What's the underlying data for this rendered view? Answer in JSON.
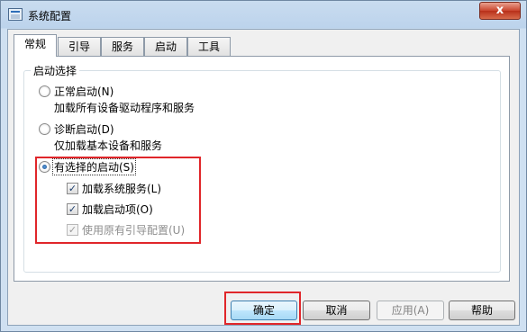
{
  "window": {
    "title": "系统配置",
    "close_glyph": "x"
  },
  "tabs": [
    {
      "label": "常规",
      "active": true
    },
    {
      "label": "引导",
      "active": false
    },
    {
      "label": "服务",
      "active": false
    },
    {
      "label": "启动",
      "active": false
    },
    {
      "label": "工具",
      "active": false
    }
  ],
  "startup_group": {
    "title": "启动选择",
    "normal": {
      "label": "正常启动(N)",
      "description": "加载所有设备驱动程序和服务",
      "selected": false
    },
    "diagnostic": {
      "label": "诊断启动(D)",
      "description": "仅加载基本设备和服务",
      "selected": false
    },
    "selective": {
      "label": "有选择的启动(S)",
      "selected": true,
      "options": [
        {
          "label": "加载系统服务(L)",
          "checked": true,
          "enabled": true
        },
        {
          "label": "加载启动项(O)",
          "checked": true,
          "enabled": true
        },
        {
          "label": "使用原有引导配置(U)",
          "checked": true,
          "enabled": false
        }
      ]
    }
  },
  "buttons": {
    "ok": "确定",
    "cancel": "取消",
    "apply": "应用(A)",
    "help": "帮助"
  },
  "colors": {
    "highlight": "#e0262a",
    "title_close": "#c9452d"
  }
}
